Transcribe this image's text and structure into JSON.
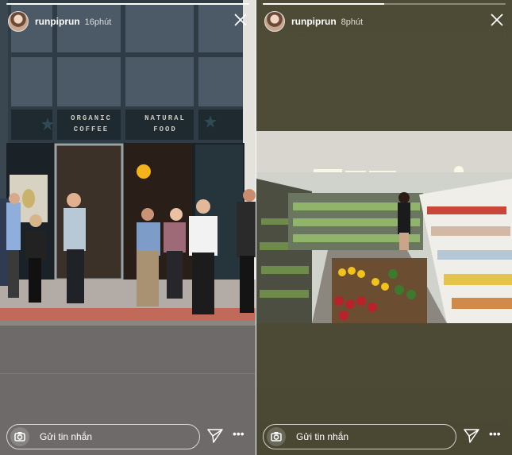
{
  "stories": [
    {
      "username": "runpiprun",
      "time": "16phút",
      "progress_fraction": 1.0,
      "message_placeholder": "Gửi tin nhắn",
      "signs": {
        "coffee": "ORGANIC COFFEE",
        "food": "NATURAL FOOD"
      }
    },
    {
      "username": "runpiprun",
      "time": "8phút",
      "progress_fraction": 0.5,
      "message_placeholder": "Gửi tin nhắn"
    }
  ],
  "icons": {
    "close": "close-icon",
    "camera": "camera-icon",
    "send": "paper-plane-icon",
    "more": "more-dots-icon"
  },
  "more_glyph": "•••"
}
